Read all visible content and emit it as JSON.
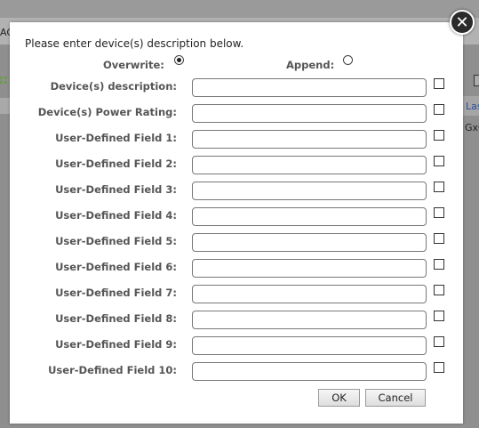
{
  "background": {
    "left_text": "AG",
    "right_link": "Las",
    "right_text": "GxO"
  },
  "dialog": {
    "intro": "Please enter device(s) description below.",
    "mode": {
      "overwrite_label": "Overwrite:",
      "append_label": "Append:",
      "selected": "overwrite"
    },
    "fields": [
      {
        "label": "Device(s) description:",
        "value": "",
        "checked": false
      },
      {
        "label": "Device(s) Power Rating:",
        "value": "",
        "checked": false
      },
      {
        "label": "User-Defined Field 1:",
        "value": "",
        "checked": false
      },
      {
        "label": "User-Defined Field 2:",
        "value": "",
        "checked": false
      },
      {
        "label": "User-Defined Field 3:",
        "value": "",
        "checked": false
      },
      {
        "label": "User-Defined Field 4:",
        "value": "",
        "checked": false
      },
      {
        "label": "User-Defined Field 5:",
        "value": "",
        "checked": false
      },
      {
        "label": "User-Defined Field 6:",
        "value": "",
        "checked": false
      },
      {
        "label": "User-Defined Field 7:",
        "value": "",
        "checked": false
      },
      {
        "label": "User-Defined Field 8:",
        "value": "",
        "checked": false
      },
      {
        "label": "User-Defined Field 9:",
        "value": "",
        "checked": false
      },
      {
        "label": "User-Defined Field 10:",
        "value": "",
        "checked": false
      }
    ],
    "ok_label": "OK",
    "cancel_label": "Cancel",
    "close_icon": "close-icon"
  }
}
